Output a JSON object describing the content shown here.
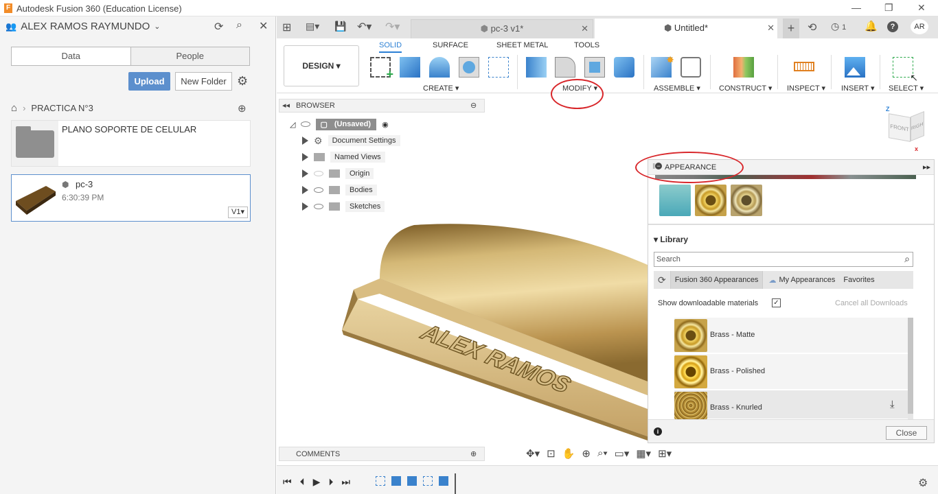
{
  "window": {
    "title": "Autodesk Fusion 360 (Education License)"
  },
  "left_panel": {
    "user": "ALEX RAMOS RAYMUNDO",
    "tabs": [
      "Data",
      "People"
    ],
    "upload_label": "Upload",
    "new_folder_label": "New Folder",
    "breadcrumb": "PRACTICA N°3",
    "items": [
      {
        "name": "PLANO SOPORTE DE CELULAR"
      },
      {
        "name": "pc-3",
        "time": "6:30:39 PM",
        "version": "V1"
      }
    ]
  },
  "doc_tabs": [
    {
      "label": "pc-3 v1*"
    },
    {
      "label": "Untitled*"
    }
  ],
  "header_right": {
    "notifications": "1",
    "avatar": "AR"
  },
  "toolbar": {
    "design": "DESIGN",
    "tabs": [
      "SOLID",
      "SURFACE",
      "SHEET METAL",
      "TOOLS"
    ],
    "groups": [
      "CREATE",
      "MODIFY",
      "ASSEMBLE",
      "CONSTRUCT",
      "INSPECT",
      "INSERT",
      "SELECT"
    ]
  },
  "browser": {
    "title": "BROWSER",
    "root": "(Unsaved)",
    "nodes": [
      "Document Settings",
      "Named Views",
      "Origin",
      "Bodies",
      "Sketches"
    ]
  },
  "model": {
    "engraving": "ALEX RAMOS"
  },
  "appearance": {
    "title": "APPEARANCE",
    "library_label": "Library",
    "search_placeholder": "Search",
    "lib_tabs": [
      "Fusion 360 Appearances",
      "My Appearances",
      "Favorites"
    ],
    "show_downloadable": "Show downloadable materials",
    "cancel_downloads": "Cancel all Downloads",
    "materials": [
      "Brass - Matte",
      "Brass - Polished",
      "Brass - Knurled"
    ],
    "close_label": "Close"
  },
  "comments": {
    "title": "COMMENTS"
  },
  "viewcube": {
    "front": "FRONT",
    "right": "RIGHT"
  },
  "colors": {
    "accent": "#2a7fd4",
    "highlight": "#d8262a",
    "brass": "#c9a24a"
  }
}
